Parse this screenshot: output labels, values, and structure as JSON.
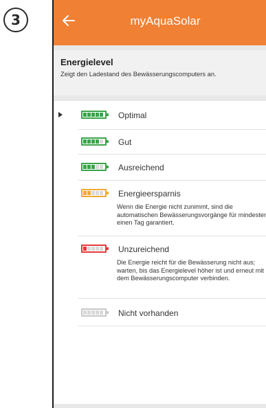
{
  "step_number": "3",
  "appbar": {
    "title": "myAquaSolar",
    "back_icon": "arrow-left-icon"
  },
  "header": {
    "title": "Energielevel",
    "subtitle": "Zeigt den Ladestand des Bewässerungscomputers an."
  },
  "levels": [
    {
      "label": "Optimal",
      "filled": 5,
      "color": "#3aa34a",
      "selected": true,
      "description": ""
    },
    {
      "label": "Gut",
      "filled": 4,
      "color": "#3aa34a",
      "selected": false,
      "description": ""
    },
    {
      "label": "Ausreichend",
      "filled": 3,
      "color": "#3aa34a",
      "selected": false,
      "description": ""
    },
    {
      "label": "Energieersparnis",
      "filled": 2,
      "color": "#f2a832",
      "selected": false,
      "description": "Wenn die Energie nicht zunimmt, sind die automatischen Bewässerungsvorgänge für mindestens einen Tag garantiert."
    },
    {
      "label": "Unzureichend",
      "filled": 1,
      "color": "#e03a3a",
      "selected": false,
      "description": "Die Energie reicht für die Bewässerung nicht aus; warten, bis das Energielevel höher ist und erneut mit dem Bewässerungscomputer verbinden."
    },
    {
      "label": "Nicht vorhanden",
      "filled": 0,
      "color": "#c8c8c8",
      "selected": false,
      "description": ""
    }
  ]
}
